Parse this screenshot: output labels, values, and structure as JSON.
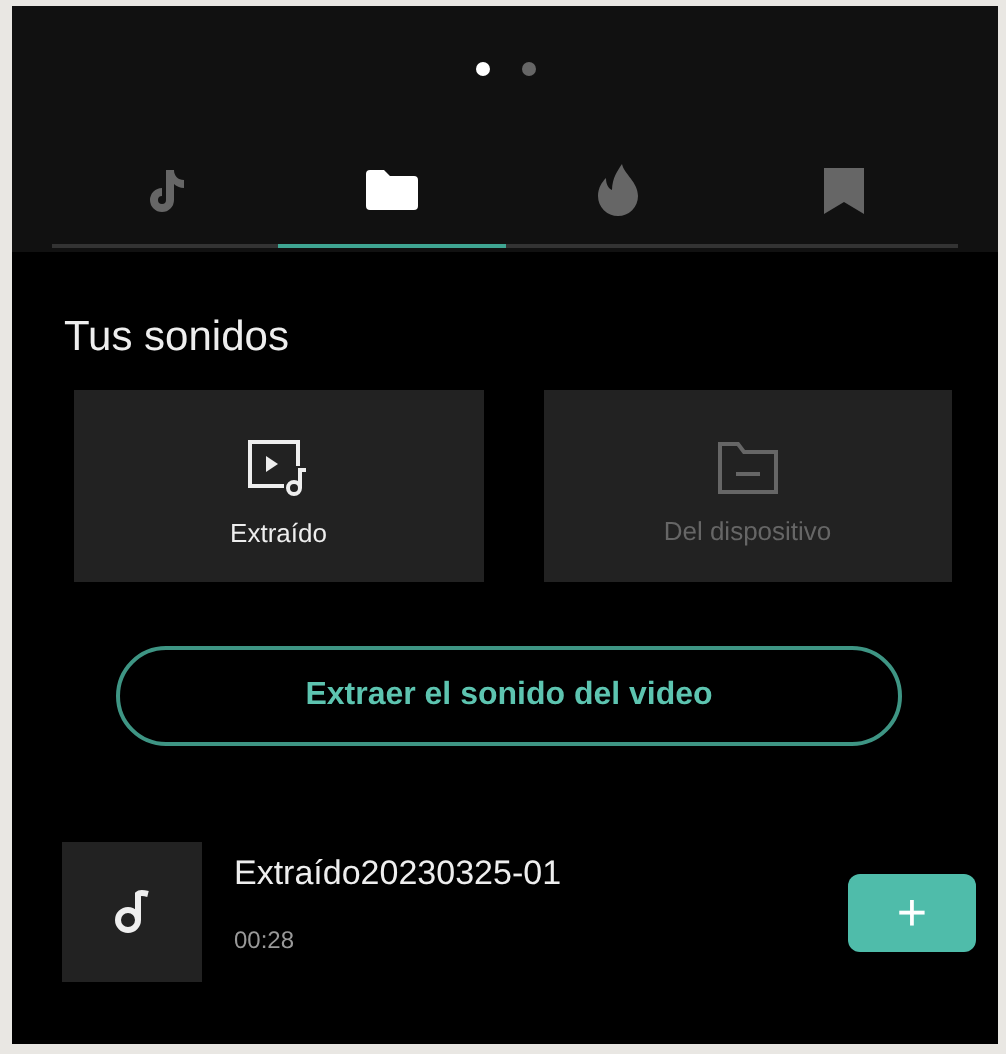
{
  "pager": [
    {
      "selected": true
    },
    {
      "selected": false
    }
  ],
  "tabs": [
    {
      "kind": "note",
      "selected": false
    },
    {
      "kind": "folder",
      "selected": true
    },
    {
      "kind": "flame",
      "selected": false
    },
    {
      "kind": "bookmark",
      "selected": false
    }
  ],
  "section_title": "Tus sonidos",
  "sources": [
    {
      "kind": "extracted",
      "label": "Extraído",
      "disabled": false
    },
    {
      "kind": "device",
      "label": "Del dispositivo",
      "disabled": true
    }
  ],
  "extract_button": "Extraer el sonido del video",
  "sounds": [
    {
      "title": "Extraído20230325-01",
      "duration": "00:28",
      "add": "+"
    }
  ]
}
